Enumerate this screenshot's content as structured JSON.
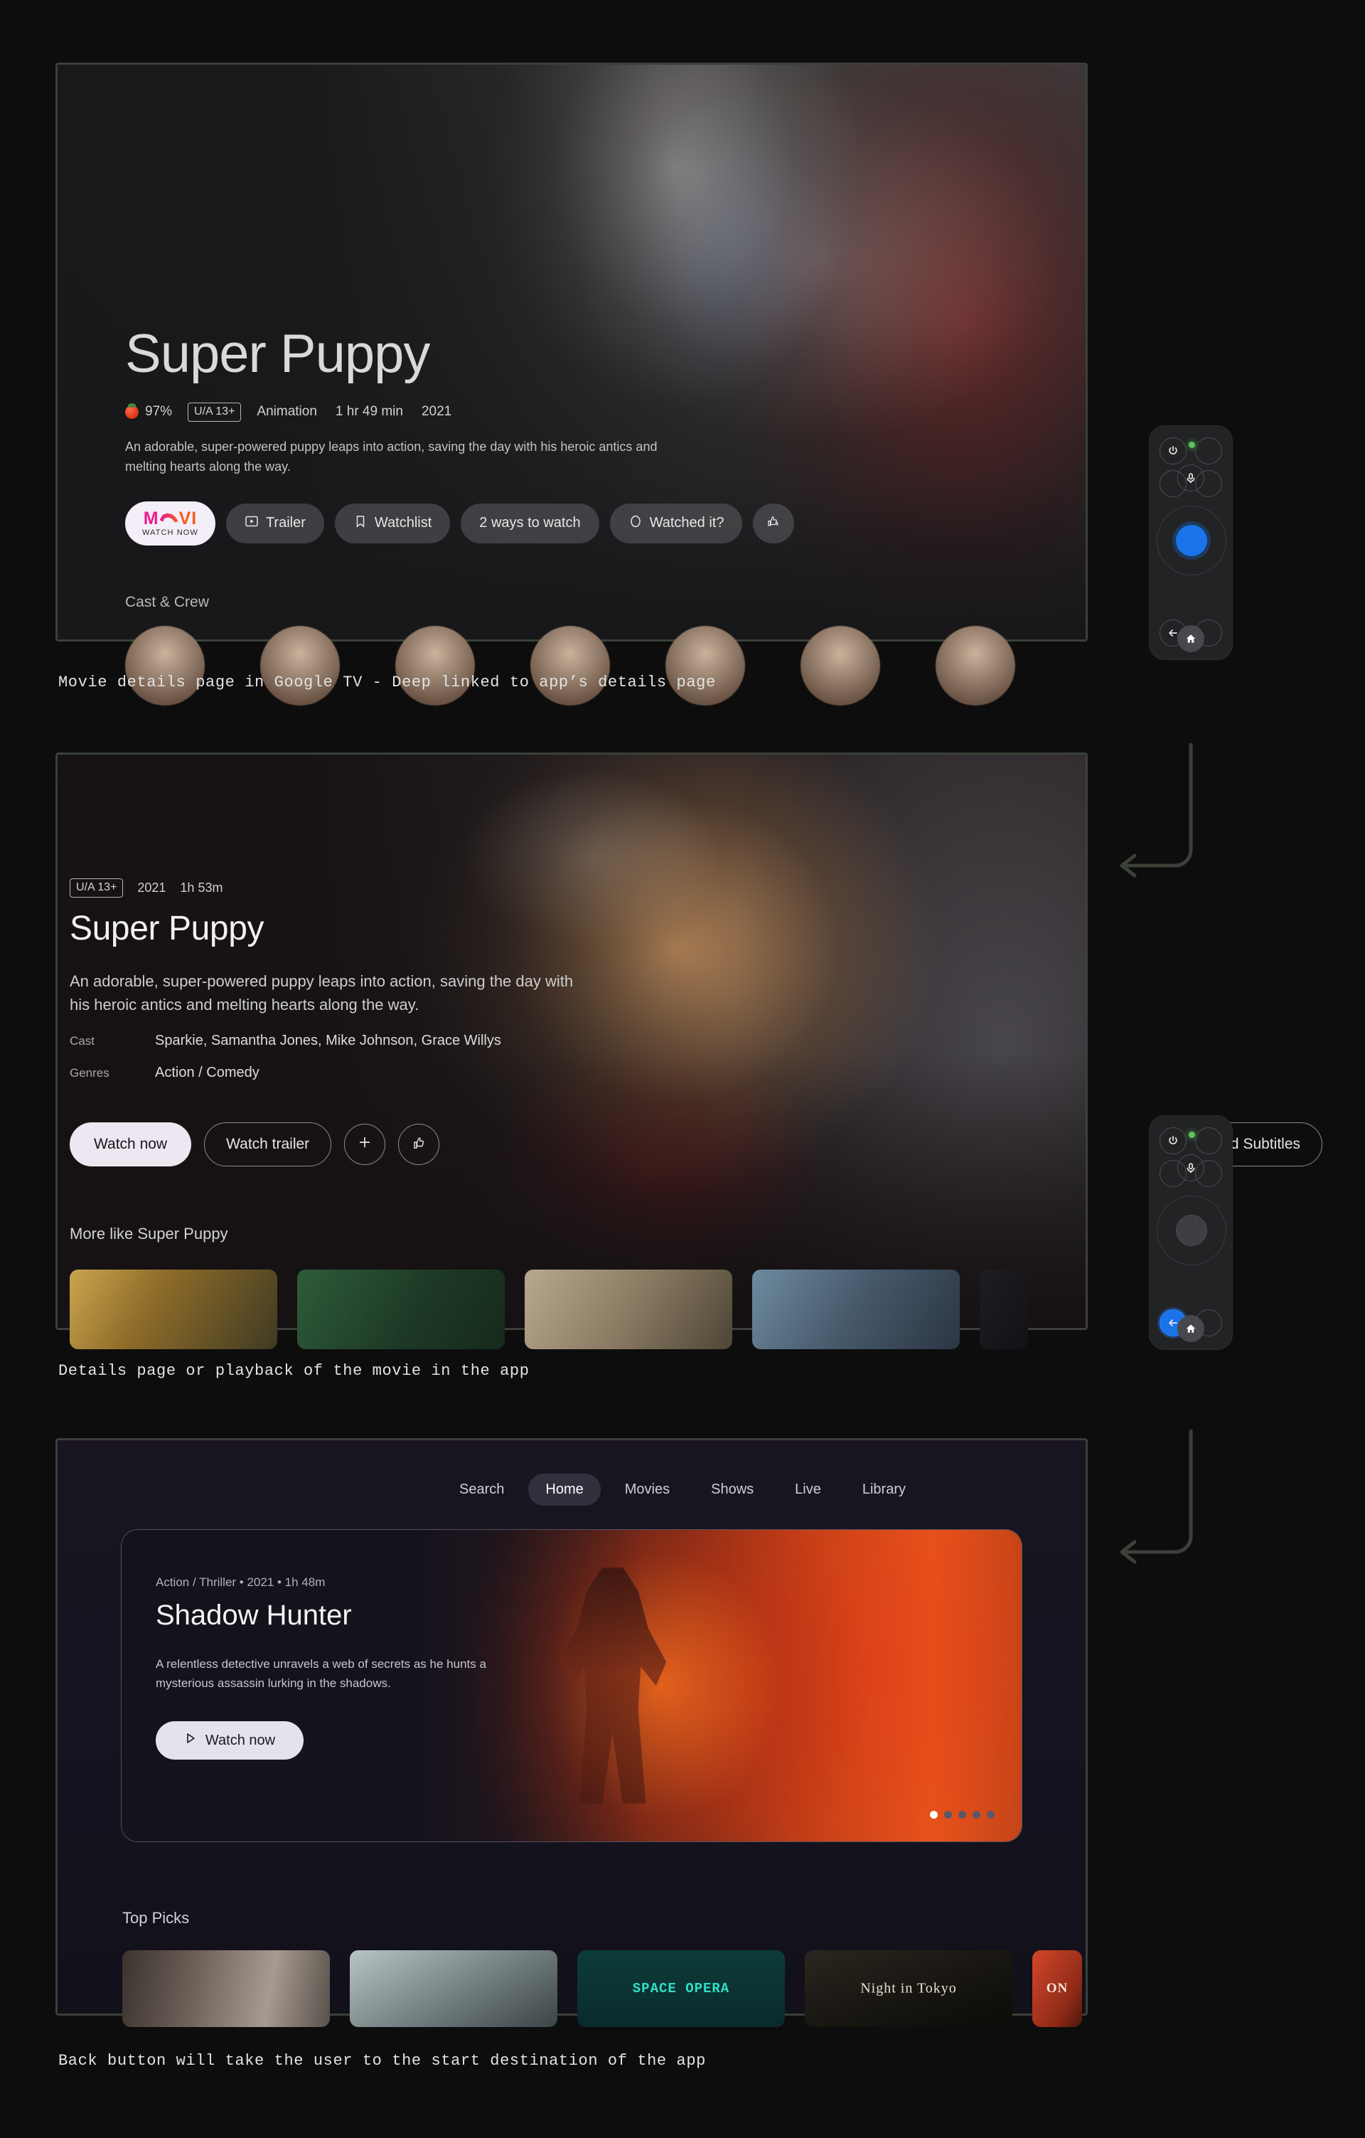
{
  "panel1": {
    "name": "google-tv-details",
    "title": "Super Puppy",
    "score": "97%",
    "rating": "U/A 13+",
    "genre": "Animation",
    "duration": "1 hr 49 min",
    "year": "2021",
    "description": "An adorable, super-powered puppy leaps into action, saving the day with his heroic antics and melting hearts along the way.",
    "watch_now": {
      "logo_m": "M",
      "logo_vi": "VI",
      "sub": "WATCH NOW"
    },
    "actions": [
      {
        "label": "Trailer",
        "icon": "play-box-icon"
      },
      {
        "label": "Watchlist",
        "icon": "bookmark-icon"
      },
      {
        "label": "2 ways to watch",
        "icon": ""
      },
      {
        "label": "Watched it?",
        "icon": "circle-icon"
      },
      {
        "label": "",
        "icon": "thumbs-icon"
      }
    ],
    "cast_crew_label": "Cast & Crew"
  },
  "caption1": "Movie details page in Google TV - Deep linked to app’s details page",
  "panel2": {
    "name": "app-details",
    "rating": "U/A 13+",
    "year": "2021",
    "duration": "1h 53m",
    "title": "Super Puppy",
    "description": "An adorable, super-powered puppy leaps into action, saving the day with his heroic antics and melting hearts along the way.",
    "cast_label": "Cast",
    "cast_value": "Sparkie, Samantha Jones, Mike Johnson, Grace Willys",
    "genres_label": "Genres",
    "genres_value": "Action / Comedy",
    "watch_now": "Watch now",
    "watch_trailer": "Watch trailer",
    "add_icon": "plus-icon",
    "like_icon": "thumbs-up-icon",
    "audio_subtitles": "Audio and Subtitles",
    "more_like_label": "More like Super Puppy"
  },
  "caption2": "Details page or playback of the movie in the app",
  "panel3": {
    "name": "app-home",
    "nav": [
      {
        "label": "Search",
        "active": false
      },
      {
        "label": "Home",
        "active": true
      },
      {
        "label": "Movies",
        "active": false
      },
      {
        "label": "Shows",
        "active": false
      },
      {
        "label": "Live",
        "active": false
      },
      {
        "label": "Library",
        "active": false
      }
    ],
    "hero": {
      "meta": "Action / Thriller • 2021 • 1h 48m",
      "title": "Shadow Hunter",
      "description": "A relentless detective unravels a web of secrets as he hunts a mysterious assassin lurking in the shadows.",
      "button": "Watch now",
      "dots_total": 5,
      "dots_active": 1
    },
    "top_picks_label": "Top Picks",
    "tiles": [
      "",
      "",
      "SPACE  OPERA",
      "Night in Tokyo",
      "ON"
    ]
  },
  "caption3": "Back button will take the user to the start destination of the app",
  "remotes": [
    {
      "name": "remote-dpad-selected",
      "buttons": {
        "power": "power-icon",
        "mic": "mic-icon",
        "back": "back-arrow-icon",
        "home": "home-icon"
      },
      "highlight": "dpad-center",
      "led_color": "#5ec45e"
    },
    {
      "name": "remote-back-selected",
      "buttons": {
        "power": "power-icon",
        "mic": "mic-icon",
        "back": "back-arrow-icon",
        "home": "home-icon"
      },
      "highlight": "back-button",
      "led_color": "#5ec45e"
    }
  ],
  "colors": {
    "background": "#0d0d0d",
    "panel_border": "#3a4038",
    "accent_blue": "#1a73e8",
    "connector": "#3b4038",
    "caption_text": "#e3e3e3"
  }
}
